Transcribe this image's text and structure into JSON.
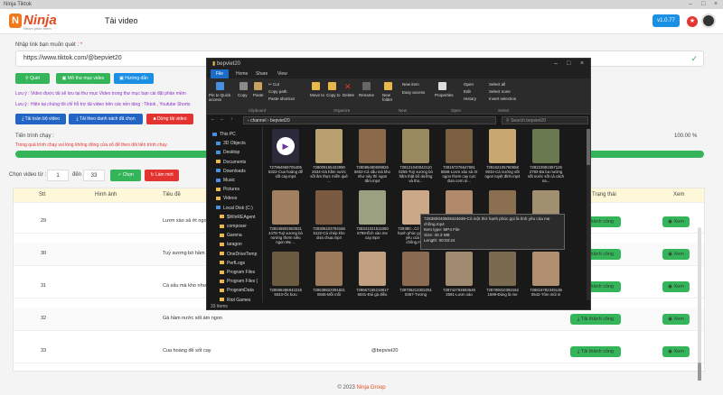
{
  "app": {
    "window_title": "Ninja Tiktok",
    "brand": "Ninja",
    "tagline": "Nhóm phần mềm",
    "page_title": "Tải video",
    "version": "v1.0.77",
    "footer_year": "© 2023",
    "footer_brand": "Ninja Group"
  },
  "form": {
    "link_label": "Nhập link bạn muốn quét :",
    "required_mark": "*",
    "url_value": "https://www.tiktok.com/@bepviet20",
    "scan_button": "Quét",
    "open_folder_button": "Mở thư mục video",
    "guide_button": "Hướng dẫn",
    "note1": "Lưu ý : Video được tải sẽ lưu tại thư mục Video trong thư mục bạn cài đặt phần mềm",
    "note2": "Lưu ý : Hiện tại chúng tôi chỉ hỗ trợ tải video trên các nền tảng : Tiktok , Youtube Shorts",
    "download_all_button": "Tải toàn bộ video",
    "download_selected_button": "Tải theo danh sách đã chọn",
    "stop_button": "Dừng tải video",
    "progress_label": "Tiến trình chạy :",
    "progress_note": "Trong quá trình chạy vui lòng không đóng cửa sổ để theo dõi tiến trình chạy",
    "progress_percent": "100.00 %",
    "progress_fraction": 1.0,
    "select_label": "Chọn video từ :",
    "from_value": "1",
    "to_label": "đến",
    "to_value": "33",
    "choose_button": "Chọn",
    "reset_button": "Làm mới"
  },
  "table": {
    "headers": [
      "Stt",
      "Hình ảnh",
      "Tiêu đề",
      "",
      "Trạng thái",
      "Xem"
    ],
    "rows": [
      {
        "stt": "29",
        "title": "Lươn xào sả ớt ngon",
        "author": "",
        "status": "Tải thành công",
        "view": "Xem"
      },
      {
        "stt": "30",
        "title": "Tuỷ xương bò hầm th",
        "author": "",
        "status": "Tải thành công",
        "view": "Xem"
      },
      {
        "stt": "31",
        "title": "Cá sấu mà kho như na",
        "author": "",
        "status": "Tải thành công",
        "view": "Xem"
      },
      {
        "stt": "32",
        "title": "Gà hầm nước sốt ám ngon",
        "author": "",
        "status": "Tải thành công",
        "view": "Xem"
      },
      {
        "stt": "33",
        "title": "Cua hoàng đế sốt cay",
        "author": "@bepviet20",
        "status": "Tải thành công",
        "view": "Xem"
      }
    ]
  },
  "explorer": {
    "title": "bepviet20",
    "tabs": [
      "File",
      "Home",
      "Share",
      "View"
    ],
    "ribbon": {
      "pin": "Pin to Quick access",
      "copy": "Copy",
      "paste": "Paste",
      "cut": "Cut",
      "copy_path": "Copy path",
      "paste_shortcut": "Paste shortcut",
      "move_to": "Move to",
      "copy_to": "Copy to",
      "delete": "Delete",
      "rename": "Rename",
      "new_folder": "New folder",
      "new_item": "New item",
      "easy_access": "Easy access",
      "properties": "Properties",
      "open": "Open",
      "edit": "Edit",
      "history": "History",
      "select_all": "Select all",
      "select_none": "Select none",
      "invert_selection": "Invert selection",
      "groups": [
        "Clipboard",
        "Organize",
        "New",
        "Open",
        "Select"
      ]
    },
    "path": [
      "channel",
      "bepviet20"
    ],
    "search_placeholder": "Search bepviet20",
    "nav": [
      {
        "label": "This PC",
        "type": "pc"
      },
      {
        "label": "3D Objects",
        "type": "b"
      },
      {
        "label": "Desktop",
        "type": "b"
      },
      {
        "label": "Documents",
        "type": "f"
      },
      {
        "label": "Downloads",
        "type": "b"
      },
      {
        "label": "Music",
        "type": "b"
      },
      {
        "label": "Pictures",
        "type": "f"
      },
      {
        "label": "Videos",
        "type": "f"
      },
      {
        "label": "Local Disk (C:)",
        "type": "b"
      },
      {
        "label": "$WinREAgent",
        "type": "f"
      },
      {
        "label": "composer",
        "type": "f"
      },
      {
        "label": "Garena",
        "type": "f"
      },
      {
        "label": "laragon",
        "type": "f"
      },
      {
        "label": "OneDriveTemp",
        "type": "f"
      },
      {
        "label": "PerfLogs",
        "type": "f"
      },
      {
        "label": "Program Files",
        "type": "f"
      },
      {
        "label": "Program Files (",
        "type": "f"
      },
      {
        "label": "ProgramData",
        "type": "f"
      },
      {
        "label": "Riot Games",
        "type": "f"
      }
    ],
    "files": [
      {
        "name": "727964969705405 5322-Cua hoàng đế sốt cay.mp4",
        "color": "#2a2a3a"
      },
      {
        "name": "728009155422990 2634-Gà hầm nước sốt ăm thực miền quê ...",
        "color": "#b8a070"
      },
      {
        "name": "728086480609826 6602-Cá sấu mà kho như này thì ngon tấm.mp4",
        "color": "#8a6a4a"
      },
      {
        "name": "728121040042110 0255-Tuỷ xương bò hầm thật bổ dưỡng và tho...",
        "color": "#9a8a60"
      },
      {
        "name": "728157276647681 5658-Lươn xào sả ớt ngon thơm cay cực đưa cơm.m...",
        "color": "#7a6040"
      },
      {
        "name": "728162105760658 9034-Cá nướng sốt ngon tuyệt đỉnh.mp4",
        "color": "#c8a870"
      },
      {
        "name": "728223981557126 2792-Ba ba nướng sốt nước sốt cá cách na...",
        "color": "#6a7a50"
      },
      {
        "name": "728245902503531 4478-Tuỷ xương bò nướng thơm siêu ngon Mẹ ...",
        "color": "#a08060"
      },
      {
        "name": "728306103784166 5122-Cá chép kho dưa chua.mp4",
        "color": "#7a5a40"
      },
      {
        "name": "728341021511050 6798-Ếch xào me cay.mp4",
        "color": "#9aa080"
      },
      {
        "name": "728380...Có một thứ hạnh phúc gọi là tình yêu của mẹ chồng.mp4",
        "color": "#caa888"
      },
      {
        "name": "728425...",
        "color": "#b08a6a"
      },
      {
        "name": "728...",
        "color": "#8a7050"
      },
      {
        "name": "7284...",
        "color": "#a09070"
      },
      {
        "name": "728595496842218 9343-Ốc bưu",
        "color": "#6a5a40"
      },
      {
        "name": "728638822091821 0846-Mỗi mỗi",
        "color": "#9a7a5a"
      },
      {
        "name": "728667155219817 6031-Đùi gà điều",
        "color": "#c0a080"
      },
      {
        "name": "728706213302251 0367-Tương",
        "color": "#8a6a50"
      },
      {
        "name": "728742793593648 2591-Lươn xào",
        "color": "#a08a70"
      },
      {
        "name": "728780810392162 1599-Đùng là me",
        "color": "#7a6a50"
      },
      {
        "name": "728816782345136 0542-Tôm mũi ni",
        "color": "#b09070"
      }
    ],
    "tooltip": {
      "name": "728380040809424639-Có một thứ hạnh phúc gọi là tình yêu của mẹ chồng.mp4",
      "type": "Item type: MP4 File",
      "size": "Size: 40.3 MB",
      "length": "Length: 00:03:24"
    },
    "status": "33 items",
    "extra_files_right": "...09625 ...ốt ...sấu nóng Hèm ...0 ...mũi ni"
  }
}
